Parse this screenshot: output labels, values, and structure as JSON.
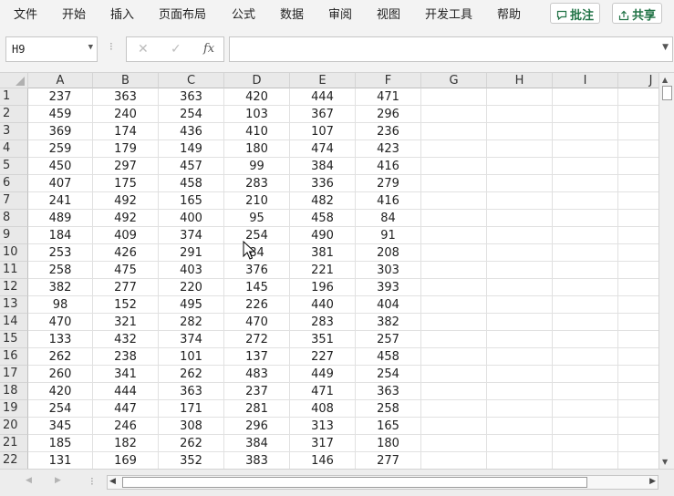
{
  "menu": {
    "items": [
      "文件",
      "开始",
      "插入",
      "页面布局",
      "公式",
      "数据",
      "审阅",
      "视图",
      "开发工具",
      "帮助"
    ],
    "comments_label": "批注",
    "share_label": "共享"
  },
  "formula_bar": {
    "name_box": "H9",
    "fx_label": "fx",
    "formula_value": ""
  },
  "grid": {
    "columns": [
      "A",
      "B",
      "C",
      "D",
      "E",
      "F",
      "G",
      "H",
      "I",
      "J"
    ],
    "rows": [
      [
        "1",
        "237",
        "363",
        "363",
        "420",
        "444",
        "471"
      ],
      [
        "2",
        "459",
        "240",
        "254",
        "103",
        "367",
        "296"
      ],
      [
        "3",
        "369",
        "174",
        "436",
        "410",
        "107",
        "236"
      ],
      [
        "4",
        "259",
        "179",
        "149",
        "180",
        "474",
        "423"
      ],
      [
        "5",
        "450",
        "297",
        "457",
        "99",
        "384",
        "416"
      ],
      [
        "6",
        "407",
        "175",
        "458",
        "283",
        "336",
        "279"
      ],
      [
        "7",
        "241",
        "492",
        "165",
        "210",
        "482",
        "416"
      ],
      [
        "8",
        "489",
        "492",
        "400",
        "95",
        "458",
        "84"
      ],
      [
        "9",
        "184",
        "409",
        "374",
        "254",
        "490",
        "91"
      ],
      [
        "10",
        "253",
        "426",
        "291",
        "84",
        "381",
        "208"
      ],
      [
        "11",
        "258",
        "475",
        "403",
        "376",
        "221",
        "303"
      ],
      [
        "12",
        "382",
        "277",
        "220",
        "145",
        "196",
        "393"
      ],
      [
        "13",
        "98",
        "152",
        "495",
        "226",
        "440",
        "404"
      ],
      [
        "14",
        "470",
        "321",
        "282",
        "470",
        "283",
        "382"
      ],
      [
        "15",
        "133",
        "432",
        "374",
        "272",
        "351",
        "257"
      ],
      [
        "16",
        "262",
        "238",
        "101",
        "137",
        "227",
        "458"
      ],
      [
        "17",
        "260",
        "341",
        "262",
        "483",
        "449",
        "254"
      ],
      [
        "18",
        "420",
        "444",
        "363",
        "237",
        "471",
        "363"
      ],
      [
        "19",
        "254",
        "447",
        "171",
        "281",
        "408",
        "258"
      ],
      [
        "20",
        "345",
        "246",
        "308",
        "296",
        "313",
        "165"
      ],
      [
        "21",
        "185",
        "182",
        "262",
        "384",
        "317",
        "180"
      ],
      [
        "22",
        "131",
        "169",
        "352",
        "383",
        "146",
        "277"
      ]
    ]
  },
  "colors": {
    "accent": "#217346",
    "header_bg": "#e9e9e9",
    "gridline": "#e1e1e1"
  }
}
